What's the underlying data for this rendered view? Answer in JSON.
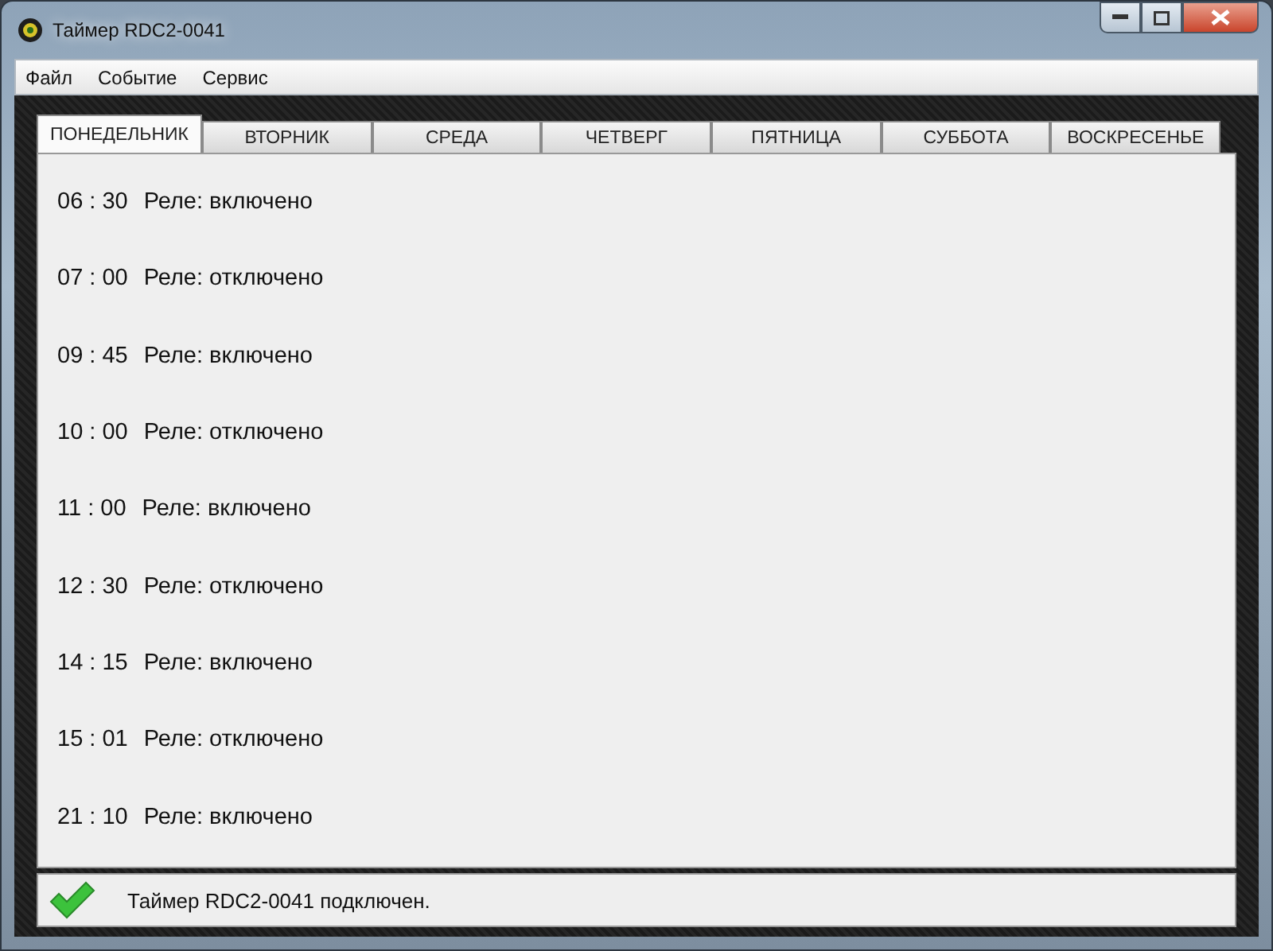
{
  "window": {
    "title": "Таймер RDC2-0041"
  },
  "menu": [
    "Файл",
    "Событие",
    "Сервис"
  ],
  "tabs": [
    {
      "label": "ПОНЕДЕЛЬНИК",
      "selected": true
    },
    {
      "label": "ВТОРНИК",
      "selected": false
    },
    {
      "label": "СРЕДА",
      "selected": false
    },
    {
      "label": "ЧЕТВЕРГ",
      "selected": false
    },
    {
      "label": "ПЯТНИЦА",
      "selected": false
    },
    {
      "label": "СУББОТА",
      "selected": false
    },
    {
      "label": "ВОСКРЕСЕНЬЕ",
      "selected": false
    }
  ],
  "events": [
    {
      "time": "06 : 30",
      "text": "Реле: включено"
    },
    {
      "time": "07 : 00",
      "text": "Реле: отключено"
    },
    {
      "time": "09 : 45",
      "text": "Реле: включено"
    },
    {
      "time": "10 : 00",
      "text": "Реле: отключено"
    },
    {
      "time": "11 : 00",
      "text": "Реле: включено"
    },
    {
      "time": "12 : 30",
      "text": "Реле: отключено"
    },
    {
      "time": "14 : 15",
      "text": "Реле: включено"
    },
    {
      "time": "15 : 01",
      "text": "Реле: отключено"
    },
    {
      "time": "21 : 10",
      "text": "Реле: включено"
    }
  ],
  "status_bar": {
    "text": "Таймер RDC2-0041 подключен."
  }
}
